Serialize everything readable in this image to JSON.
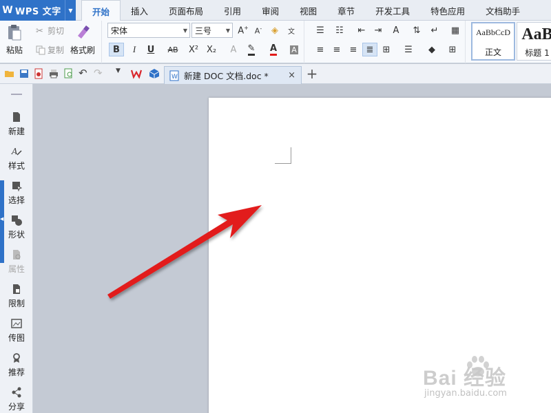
{
  "app": {
    "logo_glyph": "W",
    "title": "WPS 文字",
    "dropdown_glyph": "▼"
  },
  "menu_tabs": [
    {
      "label": "开始",
      "active": true
    },
    {
      "label": "插入"
    },
    {
      "label": "页面布局"
    },
    {
      "label": "引用"
    },
    {
      "label": "审阅"
    },
    {
      "label": "视图"
    },
    {
      "label": "章节"
    },
    {
      "label": "开发工具"
    },
    {
      "label": "特色应用"
    },
    {
      "label": "文档助手"
    }
  ],
  "ribbon": {
    "paste_label": "粘贴",
    "cut_label": "剪切",
    "copy_label": "复制",
    "format_painter_label": "格式刷",
    "font_name": "宋体",
    "font_size": "三号",
    "bold": "B",
    "italic": "I",
    "underline": "U",
    "strike": "AB",
    "superscript": "X²",
    "subscript": "X₂",
    "font_color_glyph": "A",
    "styles": [
      {
        "sample": "AaBbCcD",
        "label": "正文",
        "selected": true
      },
      {
        "sample": "AaB",
        "label": "标题 1"
      }
    ]
  },
  "quickbar": {
    "doc_tab_title": "新建 DOC 文档.doc *",
    "close_glyph": "×",
    "new_tab_glyph": "+"
  },
  "sidebar": {
    "items": [
      {
        "label": "新建",
        "icon": "new-doc-icon"
      },
      {
        "label": "样式",
        "icon": "style-icon"
      },
      {
        "label": "选择",
        "icon": "select-icon"
      },
      {
        "label": "形状",
        "icon": "shape-icon"
      },
      {
        "label": "属性",
        "icon": "properties-icon",
        "disabled": true
      },
      {
        "label": "限制",
        "icon": "restrict-icon"
      },
      {
        "label": "传图",
        "icon": "upload-image-icon"
      },
      {
        "label": "推荐",
        "icon": "recommend-icon"
      },
      {
        "label": "分享",
        "icon": "share-icon"
      }
    ]
  },
  "watermark": {
    "brand": "Bai 经验",
    "url": "jingyan.baidu.com"
  },
  "colors": {
    "accent": "#2f72c8",
    "arrow": "#e21b1b"
  }
}
